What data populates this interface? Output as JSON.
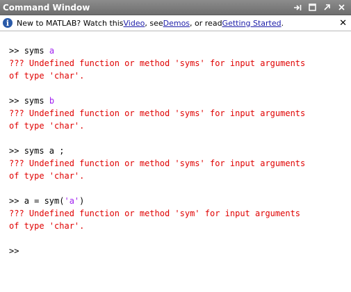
{
  "window": {
    "title": "Command Window",
    "controls": [
      "undock-icon",
      "maximize-icon",
      "minimize-icon",
      "close-icon"
    ]
  },
  "infobar": {
    "text_1": "New to MATLAB? Watch this ",
    "link_video": "Video",
    "text_2": ", see ",
    "link_demos": "Demos",
    "text_3": ", or read ",
    "link_getting_started": "Getting Started",
    "text_4": "."
  },
  "console": {
    "entries": [
      {
        "prompt": ">> ",
        "command_prefix": "syms ",
        "command_arg": "a",
        "command_suffix": "",
        "error_line1": "??? Undefined function or method 'syms' for input arguments",
        "error_line2": "of type 'char'."
      },
      {
        "prompt": ">> ",
        "command_prefix": "syms ",
        "command_arg": "b",
        "command_suffix": "",
        "error_line1": "??? Undefined function or method 'syms' for input arguments",
        "error_line2": "of type 'char'."
      },
      {
        "prompt": ">> ",
        "command_prefix": "syms a ;",
        "command_arg": "",
        "command_suffix": "",
        "error_line1": "??? Undefined function or method 'syms' for input arguments",
        "error_line2": "of type 'char'."
      },
      {
        "prompt": ">> ",
        "command_prefix": "a = sym(",
        "command_arg": "'a'",
        "command_suffix": ")",
        "error_line1": "??? Undefined function or method 'sym' for input arguments",
        "error_line2": "of type 'char'."
      }
    ],
    "current_prompt": ">>"
  },
  "colors": {
    "error": "#e00000",
    "string_arg": "#a020f0",
    "link": "#1c1ca8",
    "titlebar": "#7d7d7d"
  }
}
